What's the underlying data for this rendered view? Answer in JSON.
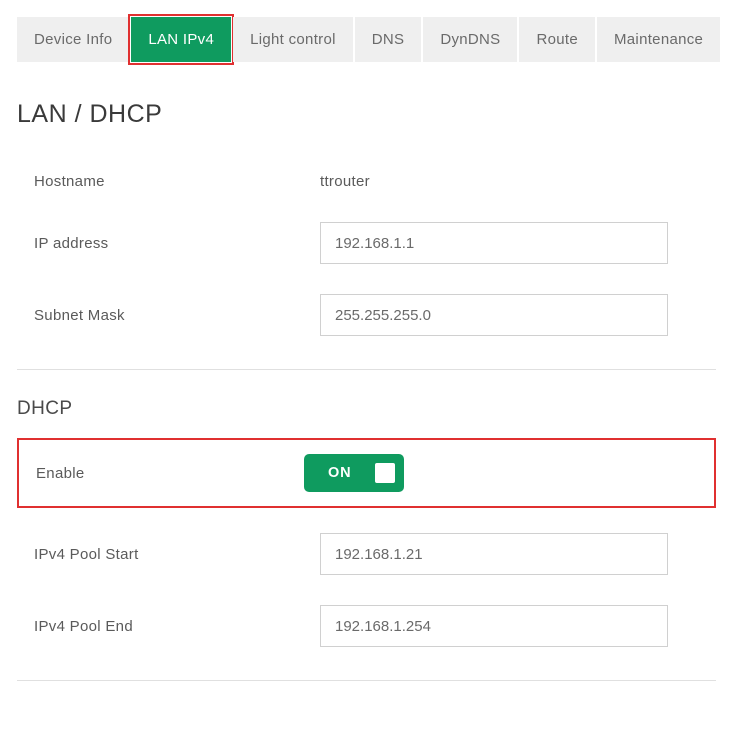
{
  "tabs": [
    {
      "label": "Device Info",
      "active": false
    },
    {
      "label": "LAN IPv4",
      "active": true
    },
    {
      "label": "Light control",
      "active": false
    },
    {
      "label": "DNS",
      "active": false
    },
    {
      "label": "DynDNS",
      "active": false
    },
    {
      "label": "Route",
      "active": false
    },
    {
      "label": "Maintenance",
      "active": false
    }
  ],
  "page_title": "LAN / DHCP",
  "lan": {
    "hostname_label": "Hostname",
    "hostname_value": "ttrouter",
    "ip_label": "IP address",
    "ip_value": "192.168.1.1",
    "subnet_label": "Subnet Mask",
    "subnet_value": "255.255.255.0"
  },
  "dhcp": {
    "section_title": "DHCP",
    "enable_label": "Enable",
    "enable_state": "ON",
    "pool_start_label": "IPv4 Pool Start",
    "pool_start_value": "192.168.1.21",
    "pool_end_label": "IPv4 Pool End",
    "pool_end_value": "192.168.1.254"
  }
}
